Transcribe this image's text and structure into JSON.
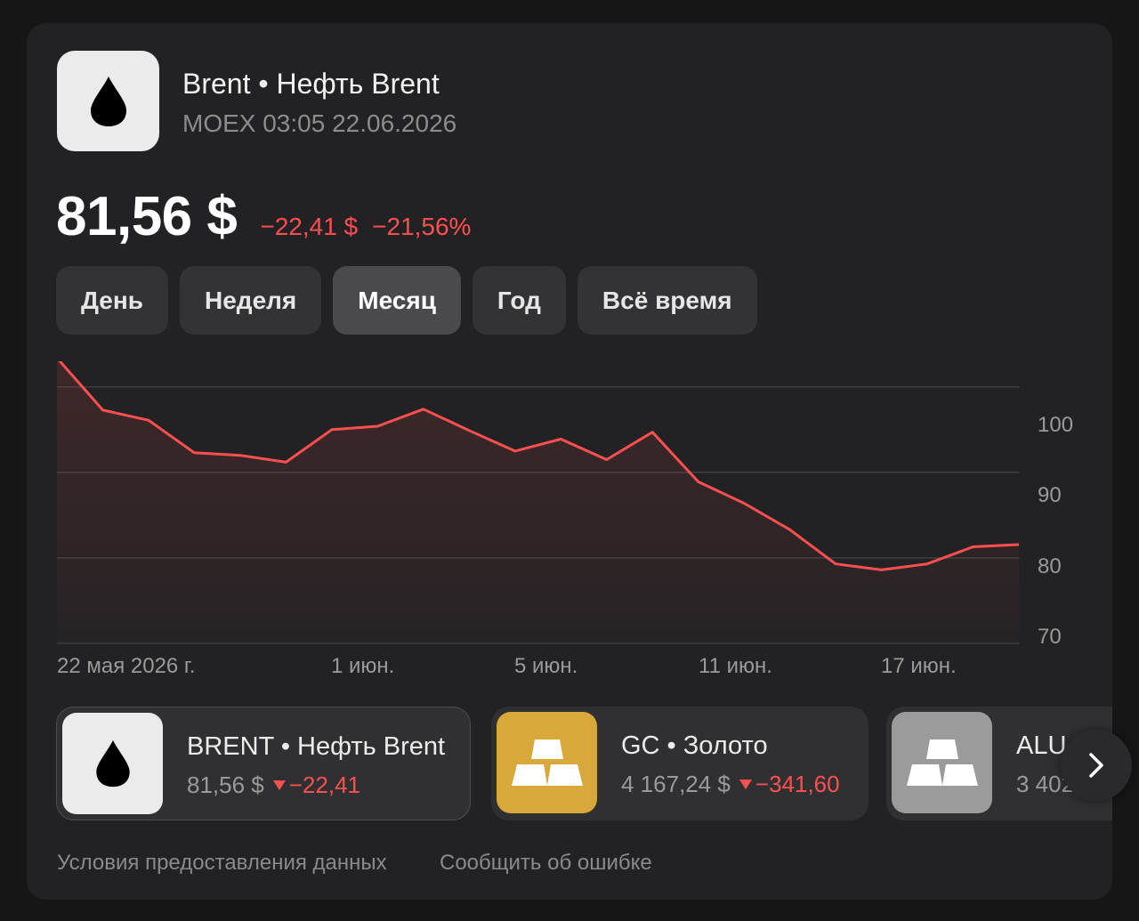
{
  "header": {
    "title": "Brent • Нефть Brent",
    "exchange_time": "MOEX 03:05 22.06.2026",
    "logo_icon": "oil-drop-icon"
  },
  "quote": {
    "price": "81,56 $",
    "change_abs": "−22,41 $",
    "change_pct": "−21,56%",
    "change_color": "#ff4f4f"
  },
  "periods": [
    {
      "label": "День",
      "active": false
    },
    {
      "label": "Неделя",
      "active": false
    },
    {
      "label": "Месяц",
      "active": true
    },
    {
      "label": "Год",
      "active": false
    },
    {
      "label": "Всё время",
      "active": false
    }
  ],
  "chart_data": {
    "type": "area",
    "x_tick_labels": [
      "22 мая 2026 г.",
      "1 июн.",
      "5 июн.",
      "11 июн.",
      "17 июн."
    ],
    "y_tick_labels": [
      "100",
      "90",
      "80",
      "70"
    ],
    "ylim": [
      70,
      103
    ],
    "y_ticks": [
      100,
      90,
      80,
      70
    ],
    "grid": true,
    "line_color": "#ff4f4f",
    "values": [
      103.4,
      97.3,
      96.1,
      92.3,
      92.0,
      91.2,
      95.0,
      95.4,
      97.4,
      94.9,
      92.5,
      93.9,
      91.5,
      94.7,
      88.9,
      86.4,
      83.3,
      79.3,
      78.6,
      79.3,
      81.3,
      81.56
    ]
  },
  "tiles": [
    {
      "name": "BRENT • Нефть Brent",
      "price": "81,56 $",
      "change": "−22,41",
      "logo": "oil-drop-icon",
      "logo_bg": "#ebebeb"
    },
    {
      "name": "GC • Золото",
      "price": "4 167,24 $",
      "change": "−341,60",
      "logo": "gold-bars-icon",
      "logo_bg": "#d9a83a"
    },
    {
      "name": "ALU",
      "price": "3 402",
      "logo": "metal-bars-icon",
      "logo_bg": "#9b9b9b"
    }
  ],
  "footer": {
    "terms": "Условия предоставления данных",
    "report": "Сообщить об ошибке"
  }
}
